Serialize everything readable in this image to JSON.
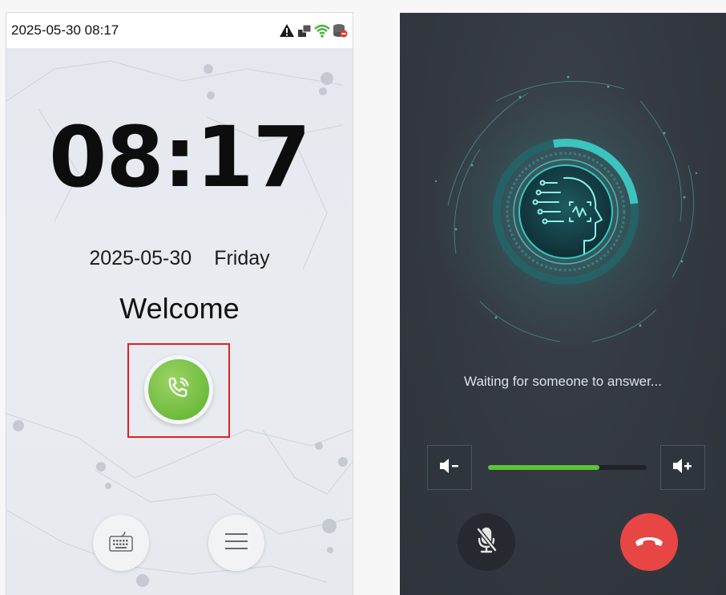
{
  "left_screen": {
    "status_bar": {
      "datetime": "2025-05-30 08:17",
      "icons": [
        "warning-icon",
        "network-icon",
        "wifi-icon",
        "database-icon"
      ]
    },
    "clock": "08:17",
    "date": "2025-05-30",
    "weekday": "Friday",
    "welcome": "Welcome",
    "buttons": {
      "call": "phone-call-icon",
      "keyboard": "keyboard-icon",
      "menu": "menu-icon"
    },
    "colors": {
      "call_green": "#6fbb3d",
      "highlight_red": "#e02020"
    }
  },
  "right_screen": {
    "status_text": "Waiting for someone to answer...",
    "volume": {
      "level": 0.7,
      "down_icon": "volume-down-icon",
      "up_icon": "volume-up-icon"
    },
    "buttons": {
      "mute": "microphone-muted-icon",
      "hangup": "hang-up-icon"
    },
    "colors": {
      "volume_fill": "#5cc43a",
      "hangup_red": "#e84545",
      "accent": "#2fc9c4"
    }
  }
}
